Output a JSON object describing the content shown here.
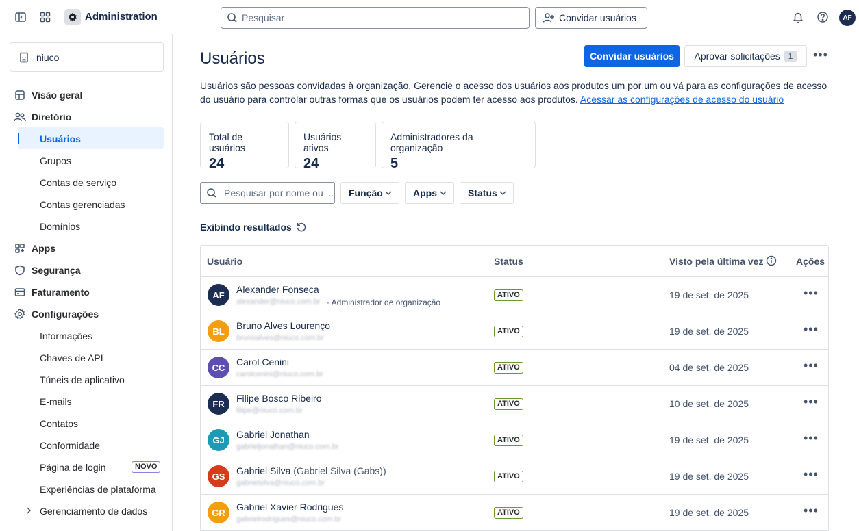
{
  "topbar": {
    "app_title": "Administration",
    "search_placeholder": "Pesquisar",
    "invite_label": "Convidar usuários",
    "avatar_initials": "AF"
  },
  "sidebar": {
    "org_name": "niuco",
    "items": [
      {
        "label": "Visão geral",
        "icon": "home-icon",
        "level": 1
      },
      {
        "label": "Diretório",
        "icon": "people-icon",
        "level": 1
      },
      {
        "label": "Usuários",
        "level": 2,
        "active": true
      },
      {
        "label": "Grupos",
        "level": 2
      },
      {
        "label": "Contas de serviço",
        "level": 2
      },
      {
        "label": "Contas gerenciadas",
        "level": 2
      },
      {
        "label": "Domínios",
        "level": 2
      },
      {
        "label": "Apps",
        "icon": "apps-icon",
        "level": 1
      },
      {
        "label": "Segurança",
        "icon": "shield-icon",
        "level": 1
      },
      {
        "label": "Faturamento",
        "icon": "card-icon",
        "level": 1
      },
      {
        "label": "Configurações",
        "icon": "gear-icon",
        "level": 1
      },
      {
        "label": "Informações",
        "level": 2
      },
      {
        "label": "Chaves de API",
        "level": 2
      },
      {
        "label": "Túneis de aplicativo",
        "level": 2
      },
      {
        "label": "E-mails",
        "level": 2
      },
      {
        "label": "Contatos",
        "level": 2
      },
      {
        "label": "Conformidade",
        "level": 2
      },
      {
        "label": "Página de login",
        "level": 2,
        "badge": "NOVO"
      },
      {
        "label": "Experiências de plataforma",
        "level": 2
      },
      {
        "label": "Gerenciamento de dados",
        "level": 2,
        "expandable": true
      }
    ]
  },
  "main": {
    "title": "Usuários",
    "invite_button": "Convidar usuários",
    "approve_button": "Aprovar solicitações",
    "approve_count": "1",
    "description": "Usuários são pessoas convidadas à organização. Gerencie o acesso dos usuários aos produtos um por um ou vá para as configurações de acesso do usuário para controlar outras formas que os usuários podem ter acesso aos produtos.",
    "description_link": "Acessar as configurações de acesso do usuário",
    "stats": [
      {
        "label": "Total de usuários",
        "value": "24"
      },
      {
        "label": "Usuários ativos",
        "value": "24"
      },
      {
        "label": "Administradores da organização",
        "value": "5"
      }
    ],
    "filter_search_placeholder": "Pesquisar por nome ou ...",
    "filters": [
      "Função",
      "Apps",
      "Status"
    ],
    "showing_label": "Exibindo resultados",
    "table": {
      "headers": [
        "Usuário",
        "Status",
        "Visto pela última vez",
        "Ações"
      ],
      "rows": [
        {
          "initials": "AF",
          "color": "#1d2d52",
          "name": "Alexander Fonseca",
          "alias": "",
          "email": "alexander@niuco.com.br",
          "role": "· Administrador de organização",
          "status": "ATIVO",
          "last_seen": "19 de set. de 2025"
        },
        {
          "initials": "BL",
          "color": "#f59e0b",
          "name": "Bruno Alves Lourenço",
          "alias": "",
          "email": "brunoalves@niuco.com.br",
          "role": "",
          "status": "ATIVO",
          "last_seen": "19 de set. de 2025"
        },
        {
          "initials": "CC",
          "color": "#5e4db2",
          "name": "Carol Cenini",
          "alias": "",
          "email": "carolcenini@niuco.com.br",
          "role": "",
          "status": "ATIVO",
          "last_seen": "04 de set. de 2025"
        },
        {
          "initials": "FR",
          "color": "#1d2d52",
          "name": "Filipe Bosco Ribeiro",
          "alias": "",
          "email": "filipe@niuco.com.br",
          "role": "",
          "status": "ATIVO",
          "last_seen": "10 de set. de 2025"
        },
        {
          "initials": "GJ",
          "color": "#1d9bb6",
          "name": "Gabriel Jonathan",
          "alias": "",
          "email": "gabrieljonathan@niuco.com.br",
          "role": "",
          "status": "ATIVO",
          "last_seen": "19 de set. de 2025"
        },
        {
          "initials": "GS",
          "color": "#d83b1b",
          "name": "Gabriel Silva",
          "alias": "(Gabriel Silva (Gabs))",
          "email": "gabrielsilva@niuco.com.br",
          "role": "",
          "status": "ATIVO",
          "last_seen": "19 de set. de 2025"
        },
        {
          "initials": "GR",
          "color": "#f59e0b",
          "name": "Gabriel Xavier Rodrigues",
          "alias": "",
          "email": "gabrielrodrigues@niuco.com.br",
          "role": "",
          "status": "ATIVO",
          "last_seen": "19 de set. de 2025"
        }
      ]
    }
  }
}
